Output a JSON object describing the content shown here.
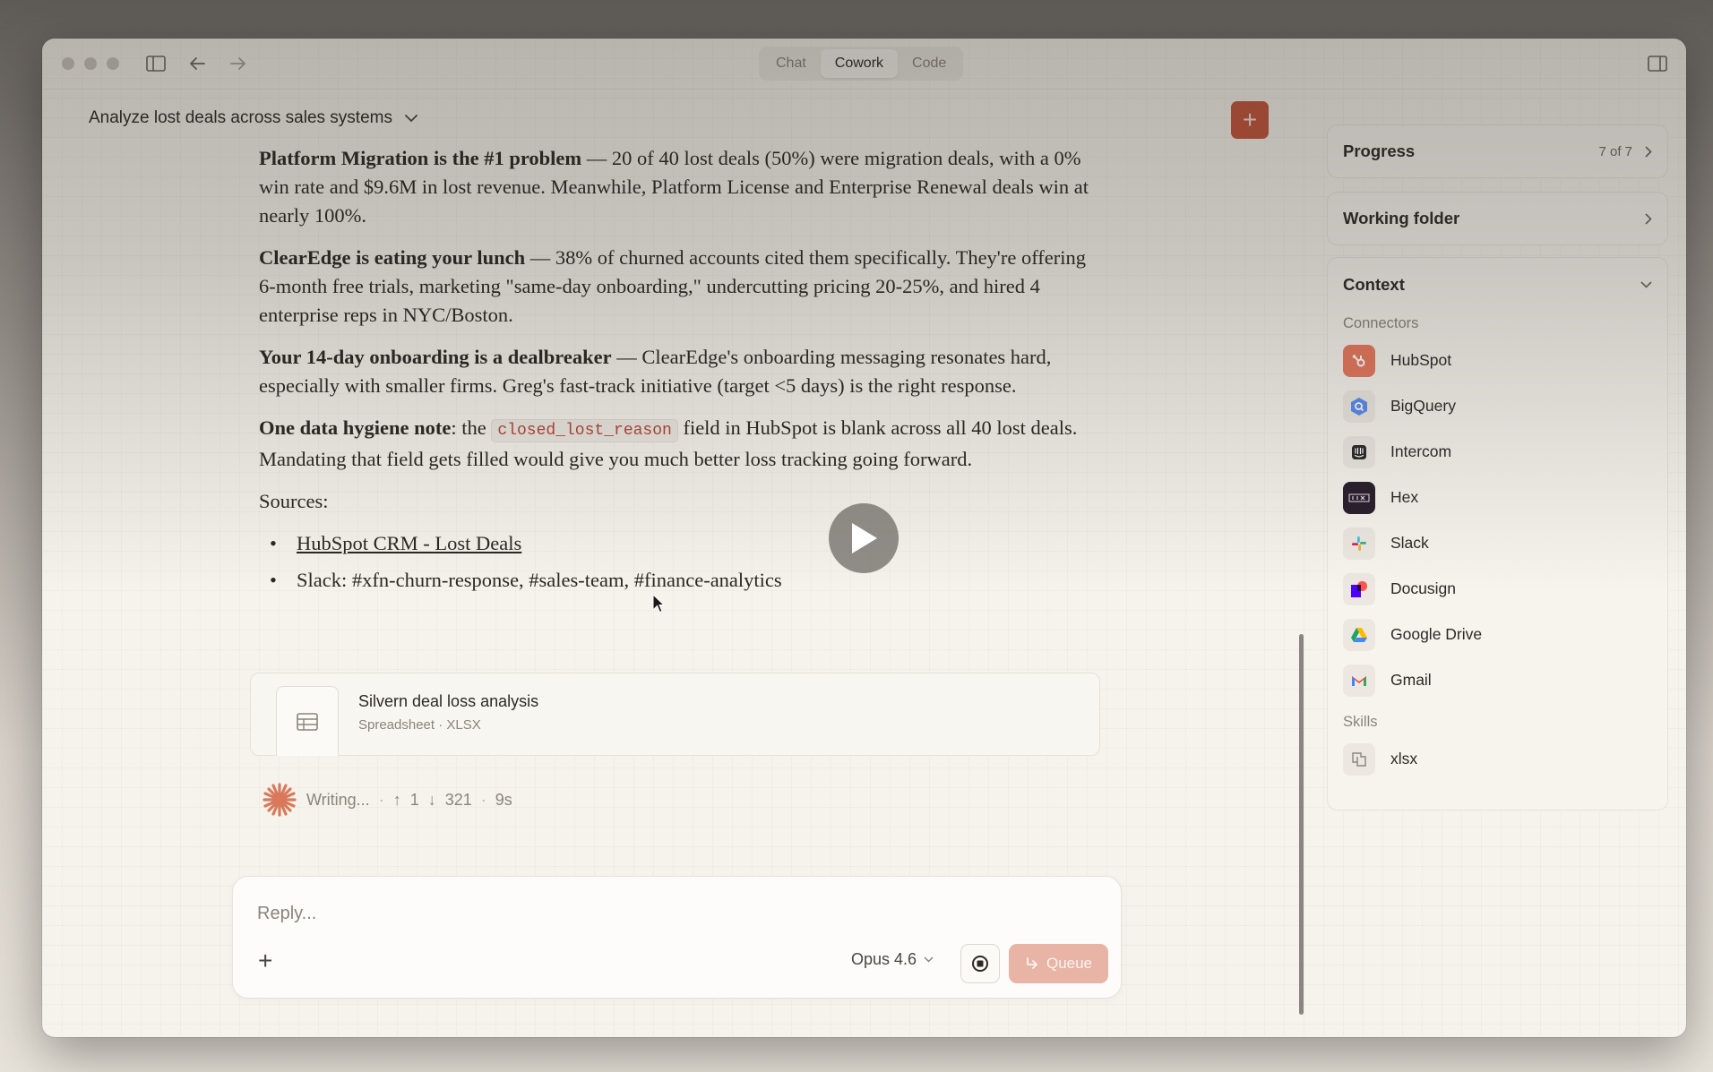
{
  "tabs": [
    {
      "label": "Chat",
      "active": false
    },
    {
      "label": "Cowork",
      "active": true
    },
    {
      "label": "Code",
      "active": false
    }
  ],
  "conversation": {
    "title": "Analyze lost deals across sales systems"
  },
  "message": {
    "p1_bold": "Platform Migration is the #1 problem",
    "p1_rest": " — 20 of 40 lost deals (50%) were migration deals, with a 0% win rate and $9.6M in lost revenue. Meanwhile, Platform License and Enterprise Renewal deals win at nearly 100%.",
    "p2_bold": "ClearEdge is eating your lunch",
    "p2_rest": " — 38% of churned accounts cited them specifically. They're offering 6-month free trials, marketing \"same-day onboarding,\" undercutting pricing 20-25%, and hired 4 enterprise reps in NYC/Boston.",
    "p3_bold": "Your 14-day onboarding is a dealbreaker",
    "p3_rest": " — ClearEdge's onboarding messaging resonates hard, especially with smaller firms. Greg's fast-track initiative (target <5 days) is the right response.",
    "p4_bold": "One data hygiene note",
    "p4_mid": ": the ",
    "p4_code": "closed_lost_reason",
    "p4_rest": " field in HubSpot is blank across all 40 lost deals. Mandating that field gets filled would give you much better loss tracking going forward.",
    "sources_label": "Sources:",
    "source_link": "HubSpot CRM - Lost Deals",
    "source_slack": "Slack: #xfn-churn-response, #sales-team, #finance-analytics"
  },
  "file": {
    "name": "Silvern deal loss analysis",
    "meta": "Spreadsheet · XLSX"
  },
  "status": {
    "text": "Writing...",
    "up": "1",
    "down": "321",
    "time": "9s"
  },
  "composer": {
    "placeholder": "Reply...",
    "model": "Opus 4.6",
    "queue_label": "Queue"
  },
  "sidebar": {
    "progress": {
      "label": "Progress",
      "count": "7 of 7"
    },
    "working_folder": {
      "label": "Working folder"
    },
    "context": {
      "label": "Context",
      "connectors_label": "Connectors",
      "connectors": [
        {
          "name": "HubSpot",
          "icon": "hubspot-icon",
          "color": "#e06a4f"
        },
        {
          "name": "BigQuery",
          "icon": "bigquery-icon",
          "color": "#4a7fe0"
        },
        {
          "name": "Intercom",
          "icon": "intercom-icon",
          "color": "#2b2b2b"
        },
        {
          "name": "Hex",
          "icon": "hex-icon",
          "color": "#2a1f2d"
        },
        {
          "name": "Slack",
          "icon": "slack-icon",
          "color": "#e01e5a"
        },
        {
          "name": "Docusign",
          "icon": "docusign-icon",
          "color": "#4c00ff"
        },
        {
          "name": "Google Drive",
          "icon": "google-drive-icon",
          "color": "#1fa463"
        },
        {
          "name": "Gmail",
          "icon": "gmail-icon",
          "color": "#ea4335"
        }
      ],
      "skills_label": "Skills",
      "skills": [
        {
          "name": "xlsx",
          "icon": "xlsx-skill-icon"
        }
      ]
    }
  }
}
